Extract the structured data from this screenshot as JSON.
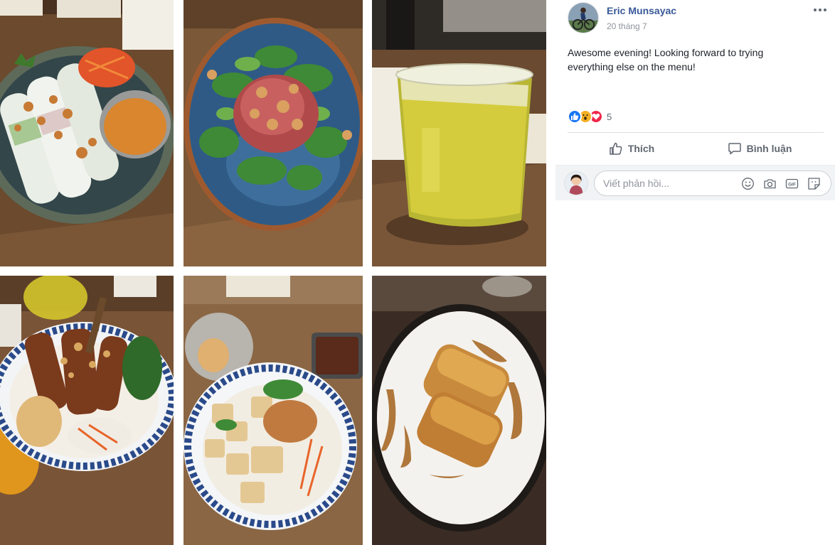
{
  "photos": [
    {
      "id": "fresh-spring-rolls"
    },
    {
      "id": "beef-salad"
    },
    {
      "id": "iced-drink"
    },
    {
      "id": "grilled-pork-vermicelli"
    },
    {
      "id": "tofu-vermicelli"
    },
    {
      "id": "puff-pastry-dessert"
    }
  ],
  "post": {
    "author_name": "Eric Munsayac",
    "time": "20 tháng 7",
    "text": "Awesome evening! Looking forward to trying everything else on the menu!",
    "reaction_count": "5",
    "reaction_icons": [
      "like-reaction-icon",
      "wow-reaction-icon",
      "love-reaction-icon"
    ]
  },
  "actions": {
    "like_label": "Thích",
    "comment_label": "Bình luận"
  },
  "comment": {
    "placeholder": "Viết phản hồi..."
  },
  "colors": {
    "name_link": "#385898",
    "meta_text": "#90949c",
    "action_text": "#606770",
    "comment_bg": "#f2f3f5",
    "like_blue": "#1877f2",
    "wow_yellow": "#f7b125",
    "love_red": "#f0284a"
  }
}
